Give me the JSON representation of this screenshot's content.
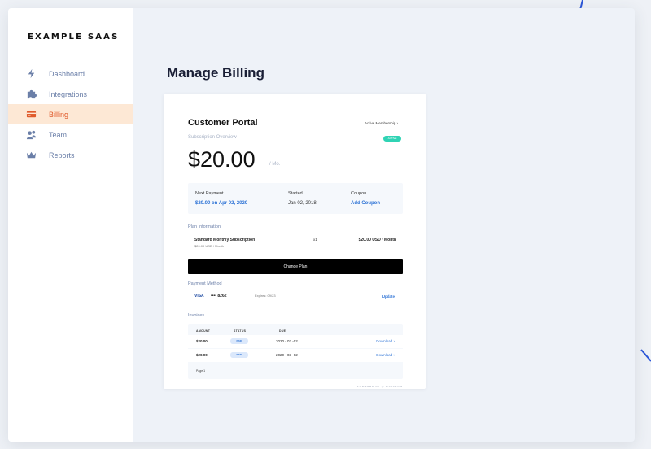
{
  "brand": "EXAMPLE SAAS",
  "sidebar": {
    "items": [
      {
        "label": "Dashboard",
        "icon": "bolt-icon"
      },
      {
        "label": "Integrations",
        "icon": "puzzle-icon"
      },
      {
        "label": "Billing",
        "icon": "credit-card-icon",
        "active": true
      },
      {
        "label": "Team",
        "icon": "users-icon"
      },
      {
        "label": "Reports",
        "icon": "crown-icon"
      }
    ]
  },
  "main": {
    "title": "Manage Billing"
  },
  "portal": {
    "title": "Customer Portal",
    "membership_link": "Active Membership  ›",
    "overview_label": "Subscription Overview",
    "status_badge": "ACTIVE",
    "price": "$20.00",
    "price_period": "/ Mo.",
    "summary": {
      "next_payment_label": "Next Payment",
      "next_payment_value": "$20.00 on Apr 02, 2020",
      "started_label": "Started",
      "started_value": "Jan 02, 2018",
      "coupon_label": "Coupon",
      "coupon_value": "Add Coupon"
    },
    "plan": {
      "section_label": "Plan Information",
      "name": "Standard Monthly Subscription",
      "sub": "$20.00 USD / Month",
      "qty": "x1",
      "price": "$20.00 USD / Month",
      "change_label": "Change Plan"
    },
    "payment": {
      "section_label": "Payment Method",
      "brand": "VISA",
      "number": "•••• 8262",
      "expires": "Expires: 09/23",
      "update_label": "Update"
    },
    "invoices": {
      "section_label": "Invoices",
      "headers": [
        "AMOUNT",
        "STATUS",
        "DUE"
      ],
      "rows": [
        {
          "amount": "$20.00",
          "status": "PAID",
          "date": "2020 - 03 -02",
          "download": "Download  ›"
        },
        {
          "amount": "$20.00",
          "status": "PAID",
          "date": "2020 - 03 -02",
          "download": "Download  ›"
        }
      ],
      "page_label": "Page 1"
    },
    "powered_by": "POWERED BY  ◎  BILLFLOW"
  },
  "colors": {
    "accent_active": "#e05a2b",
    "active_bg": "#fde8d5",
    "link": "#2f74d6",
    "badge_green": "#2fd3b4"
  }
}
